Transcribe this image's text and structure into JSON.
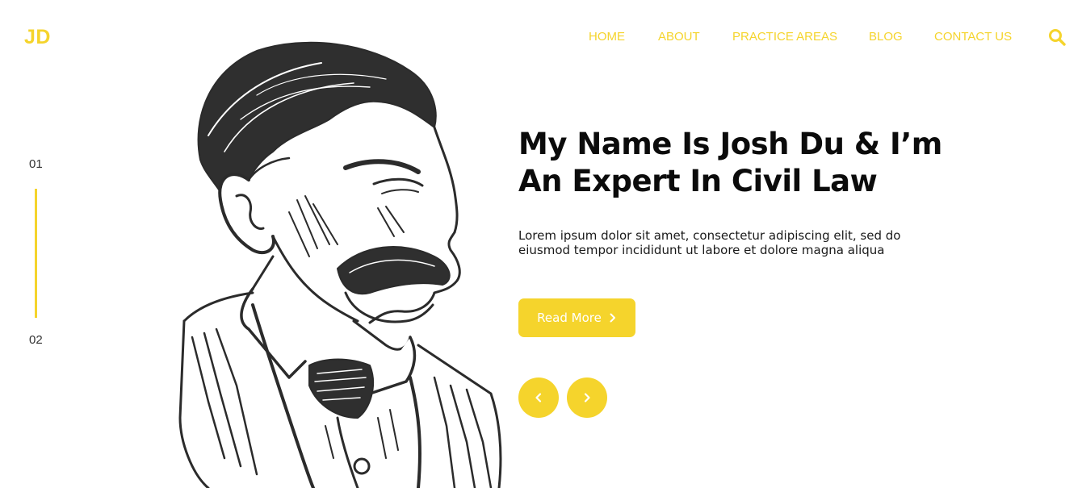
{
  "brand": {
    "logo": "JD"
  },
  "nav": {
    "items": [
      {
        "label": "HOME"
      },
      {
        "label": "ABOUT"
      },
      {
        "label": "PRACTICE AREAS"
      },
      {
        "label": "BLOG"
      },
      {
        "label": "CONTACT US"
      }
    ],
    "search_icon": "search-icon"
  },
  "slider": {
    "current": "01",
    "next": "02"
  },
  "hero": {
    "heading_line1": "My Name Is Josh Du & I’m",
    "heading_line2": "An Expert In Civil Law",
    "description_line1": "Lorem ipsum dolor sit amet, consectetur adipiscing elit, sed do",
    "description_line2": "eiusmod tempor incididunt ut labore et dolore magna aliqua",
    "button_label": "Read More",
    "button_icon": "chevron-right-icon",
    "prev_icon": "chevron-left-icon",
    "next_icon": "chevron-right-icon"
  },
  "colors": {
    "accent": "#f5d42c",
    "text": "#0b0b0b",
    "background": "#ffffff"
  }
}
